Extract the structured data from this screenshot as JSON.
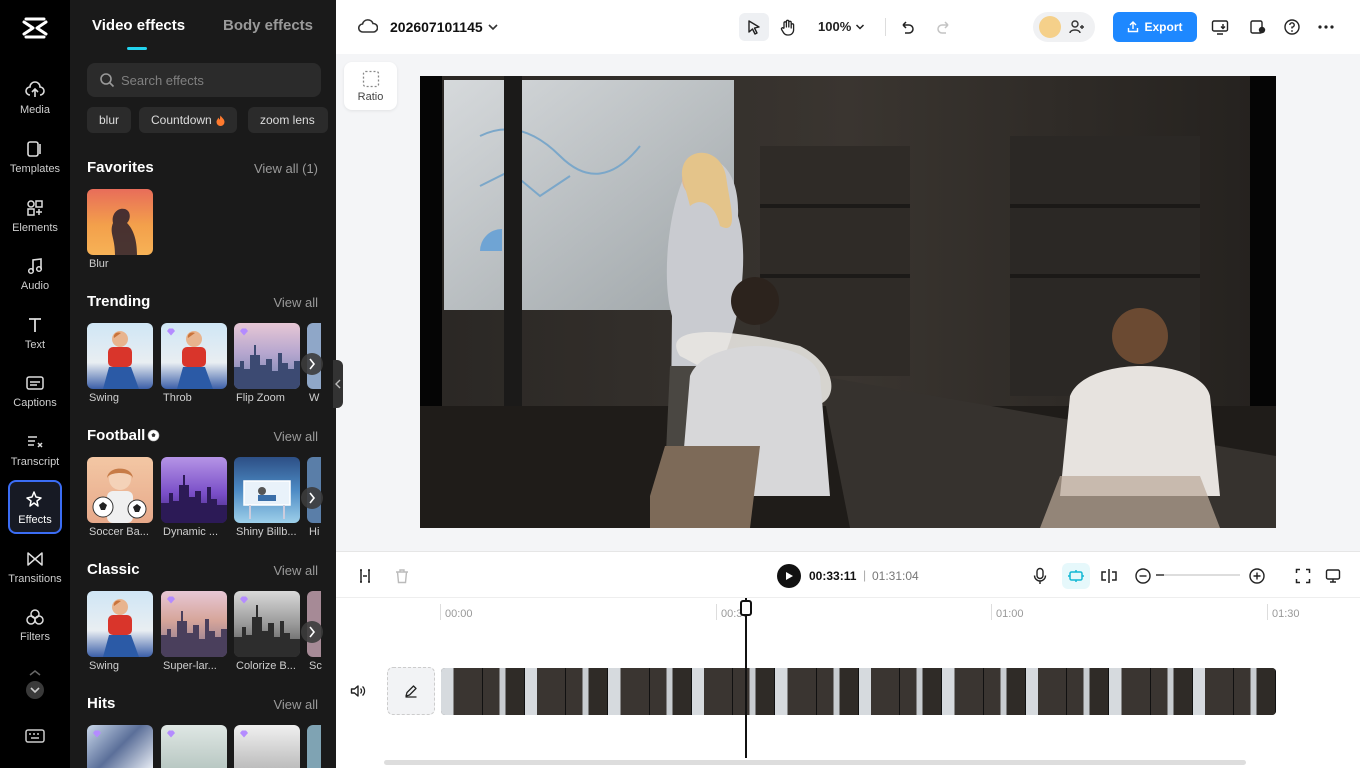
{
  "rail": {
    "items": [
      {
        "label": "Media",
        "icon": "cloud-upload-icon"
      },
      {
        "label": "Templates",
        "icon": "templates-icon"
      },
      {
        "label": "Elements",
        "icon": "elements-icon"
      },
      {
        "label": "Audio",
        "icon": "music-note-icon"
      },
      {
        "label": "Text",
        "icon": "text-icon"
      },
      {
        "label": "Captions",
        "icon": "captions-icon"
      },
      {
        "label": "Transcript",
        "icon": "transcript-icon"
      },
      {
        "label": "Effects",
        "icon": "sparkle-icon"
      },
      {
        "label": "Transitions",
        "icon": "transition-icon"
      },
      {
        "label": "Filters",
        "icon": "filters-icon"
      }
    ],
    "active": "Effects"
  },
  "panel": {
    "tabs": {
      "video": "Video effects",
      "body": "Body effects"
    },
    "search_placeholder": "Search effects",
    "chips": [
      "blur",
      "Countdown",
      "zoom lens"
    ],
    "sections": {
      "favorites": {
        "title": "Favorites",
        "view_all": "View all (1)",
        "items": [
          "Blur"
        ]
      },
      "trending": {
        "title": "Trending",
        "view_all": "View all",
        "items": [
          "Swing",
          "Throb",
          "Flip Zoom",
          "W"
        ]
      },
      "football": {
        "title": "Football",
        "view_all": "View all",
        "items": [
          "Soccer Ba...",
          "Dynamic ...",
          "Shiny Billb...",
          "Hi"
        ]
      },
      "classic": {
        "title": "Classic",
        "view_all": "View all",
        "items": [
          "Swing",
          "Super-lar...",
          "Colorize B...",
          "Sc"
        ]
      },
      "hits": {
        "title": "Hits",
        "view_all": "View all"
      }
    }
  },
  "topbar": {
    "project_name": "202607101145",
    "zoom": "100%",
    "export_label": "Export"
  },
  "canvas": {
    "ratio_label": "Ratio"
  },
  "timeline": {
    "current_time": "00:33:11",
    "separator": "|",
    "total_time": "01:31:04",
    "zoom_level": 0.1,
    "ruler": [
      "00:00",
      "00:30",
      "01:00",
      "01:30"
    ]
  },
  "colors": {
    "accent": "#22d3ee",
    "export": "#1e88ff",
    "active_rail": "#3b6df5"
  }
}
